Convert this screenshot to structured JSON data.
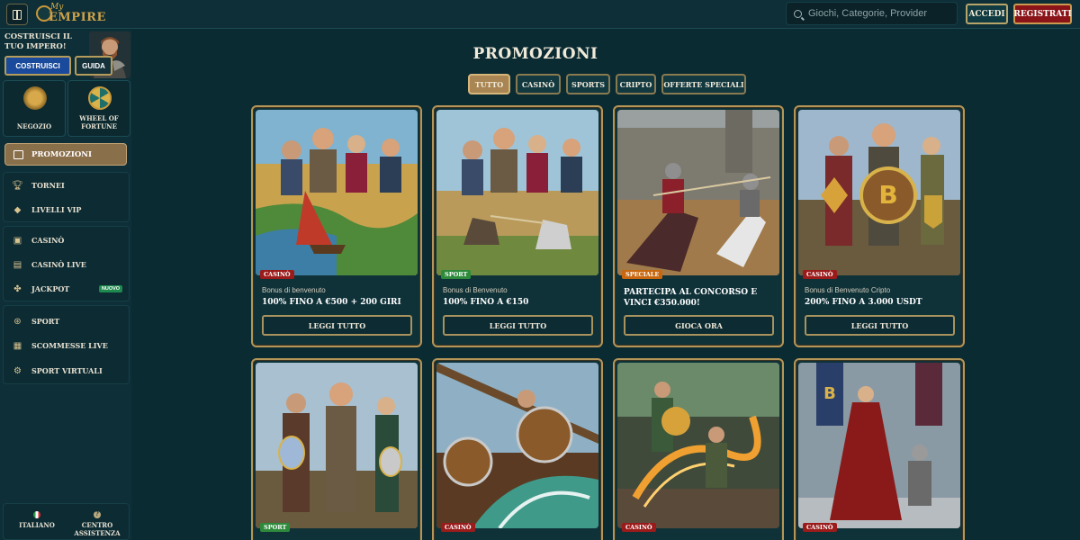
{
  "header": {
    "logo_top": "My",
    "logo_main": "EMPIRE",
    "search_placeholder": "Giochi, Categorie, Provider",
    "login_label": "ACCEDI",
    "register_label": "REGISTRATI"
  },
  "sidebar": {
    "build_text": "COSTRUISCI IL TUO IMPERO!",
    "build_button": "COSTRUISCI",
    "guide_button": "GUIDA",
    "tiles": [
      {
        "label": "NEGOZIO",
        "icon": "basket-icon"
      },
      {
        "label": "WHEEL OF FORTUNE",
        "icon": "wheel-icon"
      }
    ],
    "active_item": "PROMOZIONI",
    "group1": [
      {
        "label": "TORNEI",
        "icon": "trophy-icon"
      },
      {
        "label": "LIVELLI VIP",
        "icon": "diamond-icon"
      }
    ],
    "group2": [
      {
        "label": "CASINÒ",
        "icon": "slot-machine-icon"
      },
      {
        "label": "CASINÒ LIVE",
        "icon": "live-casino-icon"
      },
      {
        "label": "JACKPOT",
        "icon": "jackpot-icon",
        "badge": "NUOVO"
      }
    ],
    "group3": [
      {
        "label": "SPORT",
        "icon": "ball-icon"
      },
      {
        "label": "SCOMMESSE LIVE",
        "icon": "live-bet-icon"
      },
      {
        "label": "SPORT VIRTUALI",
        "icon": "virtual-sport-icon"
      }
    ],
    "footer": {
      "language": "ITALIANO",
      "help": "CENTRO ASSISTENZA"
    }
  },
  "main": {
    "title": "PROMOZIONI",
    "tabs": [
      "TUTTO",
      "CASINÒ",
      "SPORTS",
      "CRIPTO",
      "OFFERTE SPECIALI"
    ],
    "active_tab": "TUTTO",
    "cards": [
      {
        "tag": "CASINÒ",
        "tag_type": "casino",
        "subtitle": "Bonus di benvenuto",
        "headline": "100% FINO A €500 + 200 GIRI",
        "cta": "LEGGI TUTTO"
      },
      {
        "tag": "SPORT",
        "tag_type": "sport",
        "subtitle": "Bonus di Benvenuto",
        "headline": "100% FINO A €150",
        "cta": "LEGGI TUTTO"
      },
      {
        "tag": "SPECIALE",
        "tag_type": "speciale",
        "subtitle": "",
        "headline": "PARTECIPA AL CONCORSO E VINCI €350.000!",
        "cta": "GIOCA ORA"
      },
      {
        "tag": "CASINÒ",
        "tag_type": "casino",
        "subtitle": "Bonus di Benvenuto Cripto",
        "headline": "200% FINO A 3.000 USDT",
        "cta": "LEGGI TUTTO"
      },
      {
        "tag": "SPORT",
        "tag_type": "sport"
      },
      {
        "tag": "CASINÒ",
        "tag_type": "casino"
      },
      {
        "tag": "CASINÒ",
        "tag_type": "casino"
      },
      {
        "tag": "CASINÒ",
        "tag_type": "casino"
      }
    ]
  },
  "colors": {
    "background": "#0b2b33",
    "gold_border": "#b59658",
    "register": "#8b1418",
    "build": "#1a4a9b"
  }
}
